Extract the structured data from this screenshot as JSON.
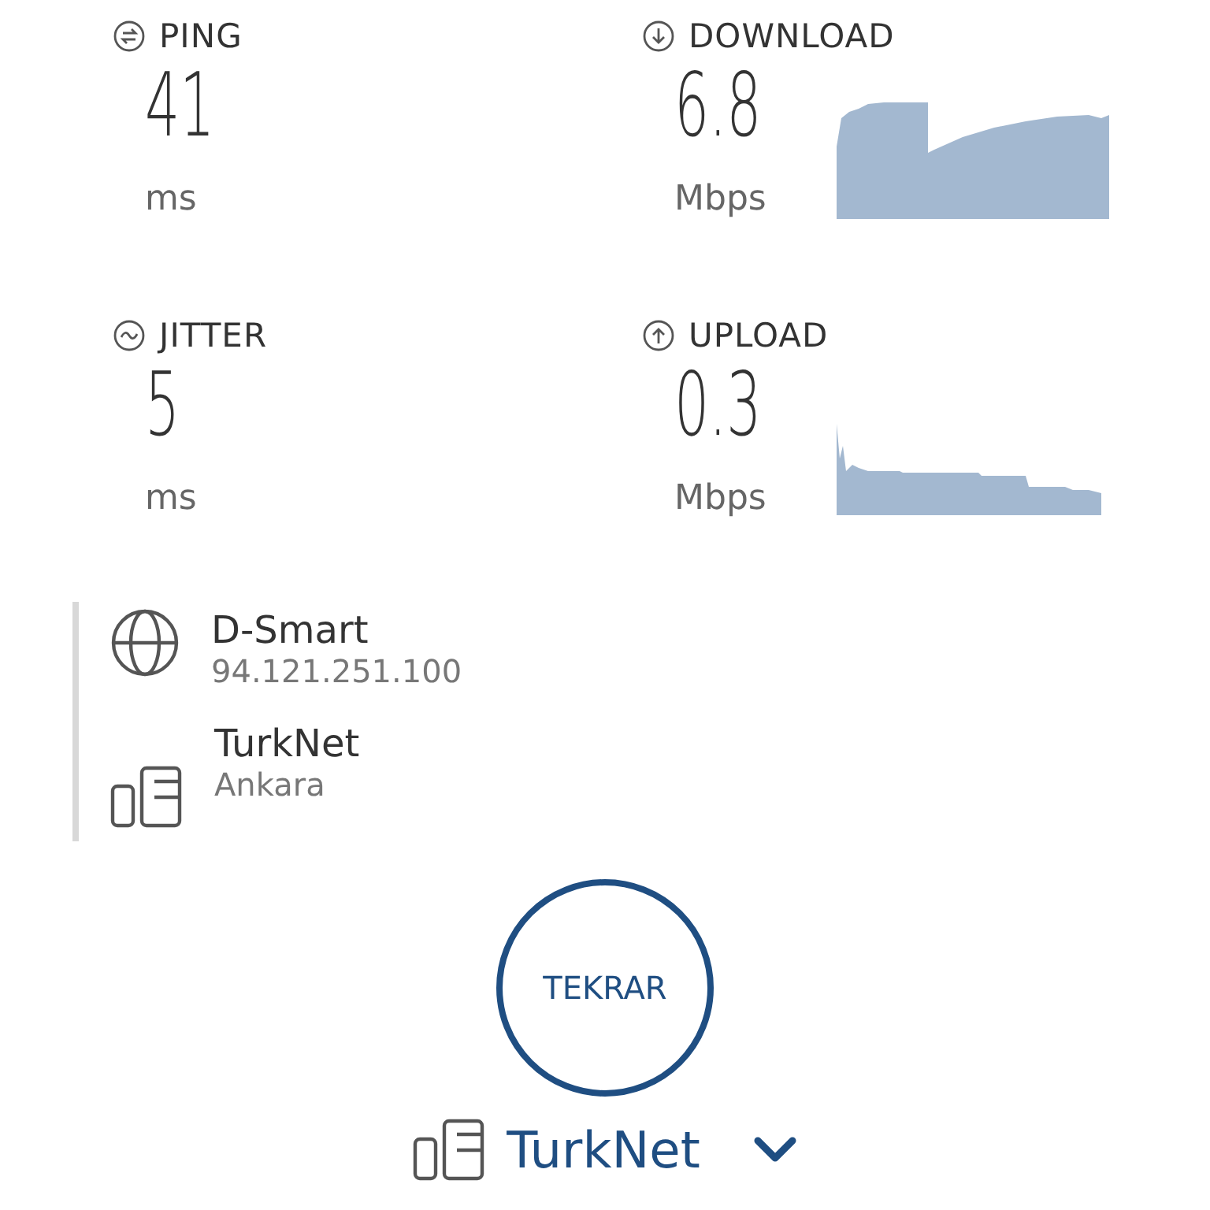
{
  "metrics": [
    {
      "kind": "ping",
      "label": "PING",
      "value": "41",
      "unit": "ms"
    },
    {
      "kind": "download",
      "label": "DOWNLOAD",
      "value": "6.8",
      "unit": "Mbps"
    },
    {
      "kind": "jitter",
      "label": "JITTER",
      "value": "5",
      "unit": "ms"
    },
    {
      "kind": "upload",
      "label": "UPLOAD",
      "value": "0.3",
      "unit": "Mbps"
    }
  ],
  "connection": [
    {
      "kind": "provider",
      "name": "D-Smart",
      "detail": "94.121.251.100"
    },
    {
      "kind": "server",
      "name": "TurkNet",
      "detail": "Ankara"
    }
  ],
  "button": "TEKRAR",
  "server_selector": {
    "name": "TurkNet"
  }
}
